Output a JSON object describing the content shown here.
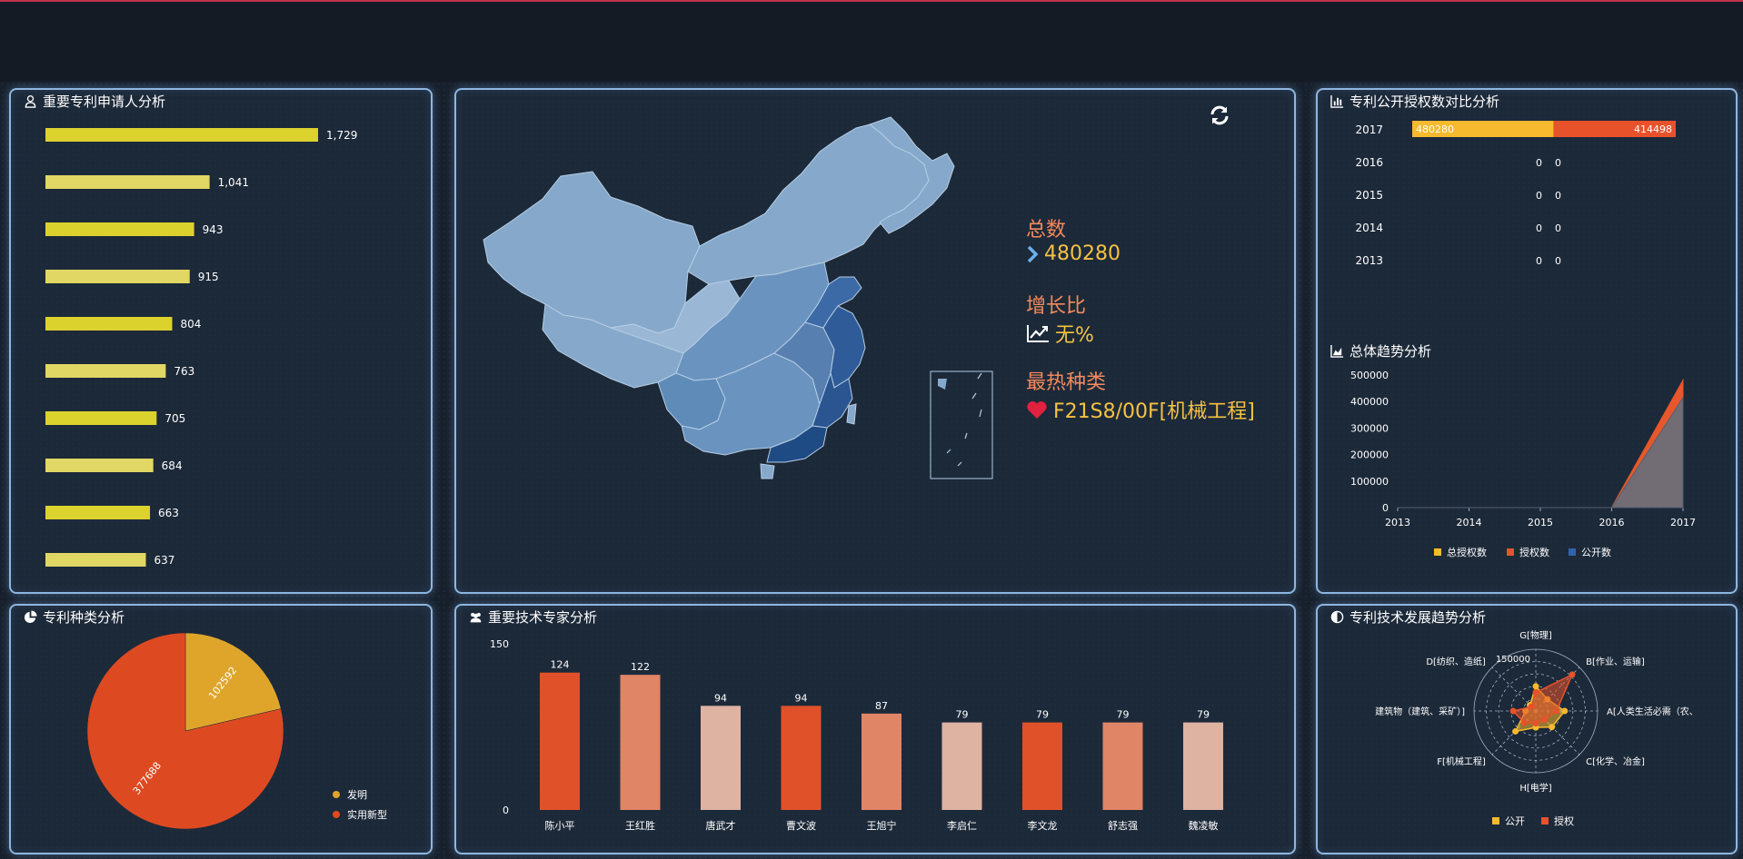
{
  "panels": {
    "applicants": {
      "title": "重要专利申请人分析"
    },
    "grant_compare": {
      "title": "专利公开授权数对比分析"
    },
    "trend": {
      "title": "总体趋势分析"
    },
    "types": {
      "title": "专利种类分析"
    },
    "experts": {
      "title": "重要技术专家分析"
    },
    "tech_trend": {
      "title": "专利技术发展趋势分析"
    }
  },
  "summary": {
    "total_label": "总数",
    "total_value": "480280",
    "growth_label": "增长比",
    "growth_value": "无%",
    "hot_label": "最热种类",
    "hot_value": "F21S8/00F[机械工程]"
  },
  "colors": {
    "applicant_bar": "#dcd22e",
    "public": "#f7b92d",
    "grant": "#e8522b",
    "public_count": "#2f64a8",
    "invention": "#dfa52b",
    "utility": "#dd4a22",
    "panel_border": "#8fb6e0"
  },
  "chart_data": [
    {
      "id": "applicants",
      "type": "bar",
      "orientation": "horizontal",
      "values": [
        1729,
        1041,
        943,
        915,
        804,
        763,
        705,
        684,
        663,
        637
      ],
      "value_labels": [
        "1,729",
        "1,041",
        "943",
        "915",
        "804",
        "763",
        "705",
        "684",
        "663",
        "637"
      ]
    },
    {
      "id": "grant_compare",
      "type": "bar",
      "orientation": "horizontal",
      "categories": [
        "2017",
        "2016",
        "2015",
        "2014",
        "2013"
      ],
      "series": [
        {
          "name": "公开",
          "values": [
            480280,
            0,
            0,
            0,
            0
          ]
        },
        {
          "name": "授权",
          "values": [
            414498,
            0,
            0,
            0,
            0
          ]
        }
      ]
    },
    {
      "id": "trend",
      "type": "area",
      "x": [
        "2013",
        "2014",
        "2015",
        "2016",
        "2017"
      ],
      "ylim": [
        0,
        500000
      ],
      "yticks": [
        "500000",
        "400000",
        "300000",
        "200000",
        "100000",
        "0"
      ],
      "series": [
        {
          "name": "总授权数",
          "values": [
            0,
            0,
            0,
            0,
            480280
          ]
        },
        {
          "name": "授权数",
          "values": [
            0,
            0,
            0,
            0,
            480280
          ]
        },
        {
          "name": "公开数",
          "values": [
            0,
            0,
            0,
            0,
            414498
          ]
        }
      ],
      "legend": [
        "总授权数",
        "授权数",
        "公开数"
      ],
      "legend_position": "bottom"
    },
    {
      "id": "types",
      "type": "pie",
      "slices": [
        {
          "name": "发明",
          "value": 102592,
          "label": "102592"
        },
        {
          "name": "实用新型",
          "value": 377688,
          "label": "377688"
        }
      ],
      "legend_position": "bottom-right"
    },
    {
      "id": "experts",
      "type": "bar",
      "categories": [
        "陈小平",
        "王红胜",
        "唐武才",
        "曹文波",
        "王旭宁",
        "李启仁",
        "李文龙",
        "舒志强",
        "魏凌敏"
      ],
      "values": [
        124,
        122,
        94,
        94,
        87,
        79,
        79,
        79,
        79
      ],
      "ylim": [
        0,
        150
      ],
      "yticks": [
        "150",
        "0"
      ],
      "bar_colors": [
        "#e0512a",
        "#e08566",
        "#deb3a2"
      ]
    },
    {
      "id": "tech_trend",
      "type": "radar",
      "axes": [
        "G[物理]",
        "B[作业、运输]",
        "A[人类生活必需（农、",
        "C[化学、冶金]",
        "H[电学]",
        "F[机械工程]",
        "E[固定建筑物（建筑、采矿）]",
        "D[纺织、造纸]"
      ],
      "axis_display": [
        "G[物理]",
        "B[作业、运输]",
        "A[人类生活必需（农、",
        "C[化学、冶金]",
        "H[电学]",
        "F[机械工程]",
        "建筑物（建筑、采矿）]",
        "D[纺织、造纸]"
      ],
      "max_label": "150000",
      "max": 150000,
      "series": [
        {
          "name": "公开",
          "values": [
            60000,
            40000,
            70000,
            55000,
            40000,
            70000,
            25000,
            20000
          ]
        },
        {
          "name": "授权",
          "values": [
            45000,
            125000,
            50000,
            30000,
            30000,
            40000,
            55000,
            15000
          ]
        }
      ],
      "legend": [
        "公开",
        "授权"
      ]
    }
  ]
}
